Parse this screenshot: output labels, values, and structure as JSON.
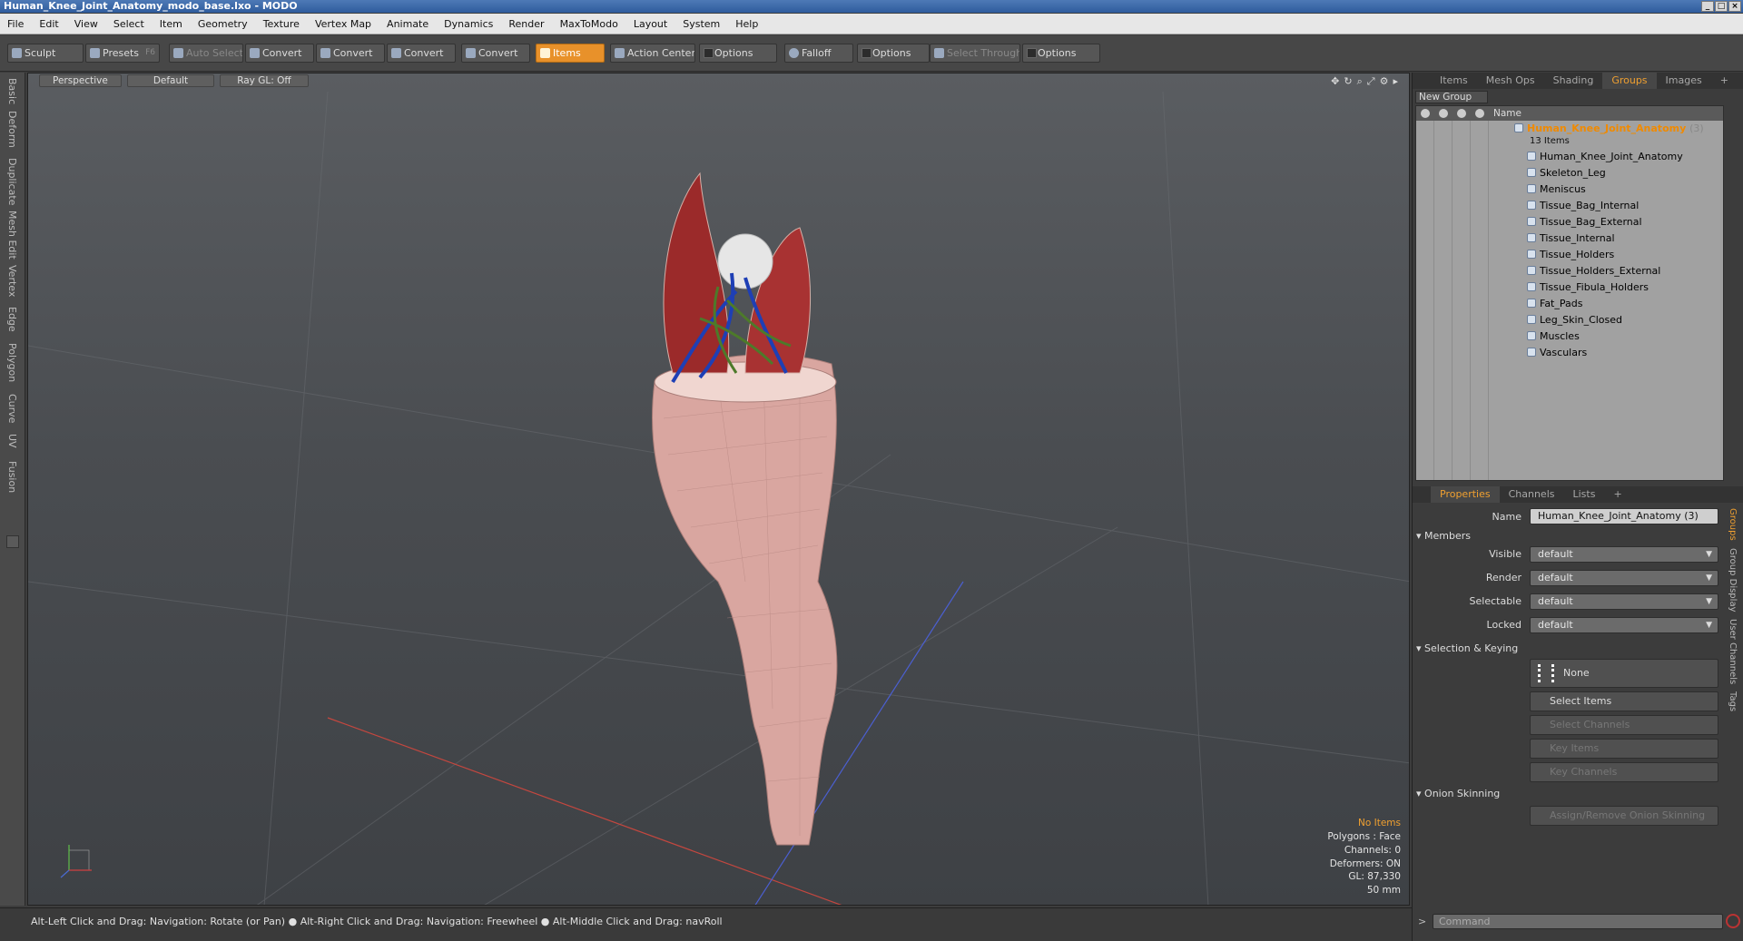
{
  "window": {
    "title": "Human_Knee_Joint_Anatomy_modo_base.lxo - MODO",
    "buttons": [
      "_",
      "□",
      "×"
    ]
  },
  "menu": [
    "File",
    "Edit",
    "View",
    "Select",
    "Item",
    "Geometry",
    "Texture",
    "Vertex Map",
    "Animate",
    "Dynamics",
    "Render",
    "MaxToModo",
    "Layout",
    "System",
    "Help"
  ],
  "toolbar": {
    "sculpt": "Sculpt",
    "presets": "Presets",
    "presets_key": "F6",
    "auto_select": "Auto Select",
    "convert1": "Convert",
    "convert2": "Convert",
    "convert3": "Convert",
    "convert4": "Convert",
    "items": "Items",
    "action_center": "Action Center",
    "options1": "Options",
    "falloff": "Falloff",
    "options2": "Options",
    "select_through": "Select Through",
    "options3": "Options"
  },
  "left_tabs": [
    "Basic",
    "Deform",
    "Duplicate",
    "Mesh Edit",
    "Vertex",
    "Edge",
    "Polygon",
    "Curve",
    "UV",
    "Fusion"
  ],
  "viewport": {
    "view": "Perspective",
    "shading": "Default",
    "raygl": "Ray GL: Off",
    "stats": {
      "no_items": "No Items",
      "polygons": "Polygons : Face",
      "channels": "Channels: 0",
      "deformers": "Deformers: ON",
      "gl": "GL: 87,330",
      "unit": "50 mm"
    }
  },
  "status": "Alt-Left Click and Drag: Navigation: Rotate (or Pan) ● Alt-Right Click and Drag: Navigation: Freewheel ● Alt-Middle Click and Drag: navRoll",
  "right_tabs": [
    "Items",
    "Mesh Ops",
    "Shading",
    "Groups",
    "Images"
  ],
  "right_tabs_active": "Groups",
  "groups": {
    "new_group": "New Group",
    "col_name": "Name",
    "root": "Human_Knee_Joint_Anatomy",
    "root_count": "(3)",
    "root_sub": "13 Items",
    "items": [
      "Human_Knee_Joint_Anatomy",
      "Skeleton_Leg",
      "Meniscus",
      "Tissue_Bag_Internal",
      "Tissue_Bag_External",
      "Tissue_Internal",
      "Tissue_Holders",
      "Tissue_Holders_External",
      "Tissue_Fibula_Holders",
      "Fat_Pads",
      "Leg_Skin_Closed",
      "Muscles",
      "Vasculars"
    ]
  },
  "props_tabs": [
    "Properties",
    "Channels",
    "Lists"
  ],
  "props": {
    "name_label": "Name",
    "name_value": "Human_Knee_Joint_Anatomy (3)",
    "members": "Members",
    "visible_label": "Visible",
    "visible": "default",
    "render_label": "Render",
    "render": "default",
    "selectable_label": "Selectable",
    "selectable": "default",
    "locked_label": "Locked",
    "locked": "default",
    "sel_keying": "Selection & Keying",
    "none": "None",
    "select_items": "Select Items",
    "select_channels": "Select Channels",
    "key_items": "Key Items",
    "key_channels": "Key Channels",
    "onion": "Onion Skinning",
    "assign_onion": "Assign/Remove Onion Skinning"
  },
  "side_tabs": [
    "Groups",
    "Group Display",
    "User Channels",
    "Tags"
  ],
  "command_placeholder": "Command",
  "colors": {
    "accent": "#f0a030",
    "title": "#2f5c9d"
  }
}
